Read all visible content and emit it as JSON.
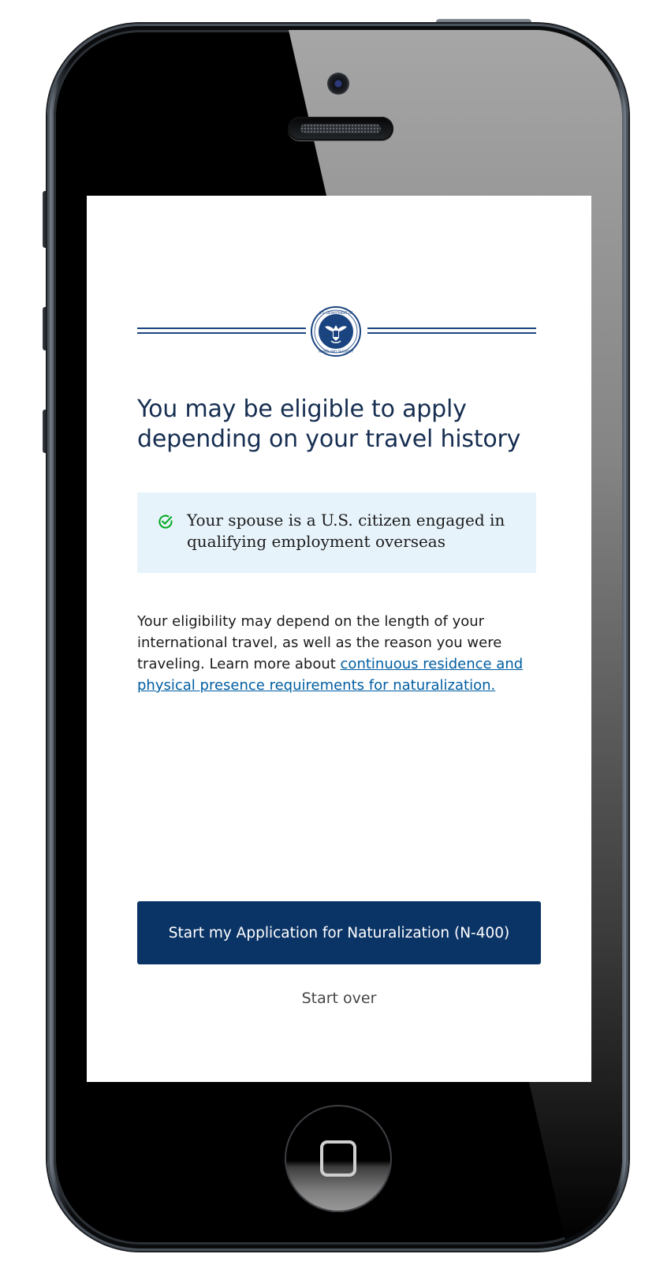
{
  "header": {
    "seal_lettering": "U.S. DEPARTMENT OF HOMELAND SECURITY"
  },
  "main": {
    "title": "You may be eligible to apply depending on your travel history",
    "eligibility_item": "Your spouse is a U.S. citizen engaged in qualifying employment overseas",
    "body_prefix": "Your eligibility may depend on the length of your international travel, as well as the reason you were traveling. Learn more about ",
    "body_link": "continuous residence and physical presence requirements for naturalization."
  },
  "actions": {
    "primary_label": "Start my Application for Naturalization (N-400)",
    "secondary_label": "Start over"
  },
  "icons": {
    "check": "check-circle-icon",
    "seal": "dhs-seal-icon",
    "home": "home-button-icon"
  },
  "colors": {
    "heading": "#162e51",
    "primary_button": "#0b3466",
    "highlight_box": "#e7f3fb",
    "link": "#005ea2",
    "check": "#00a91c"
  }
}
